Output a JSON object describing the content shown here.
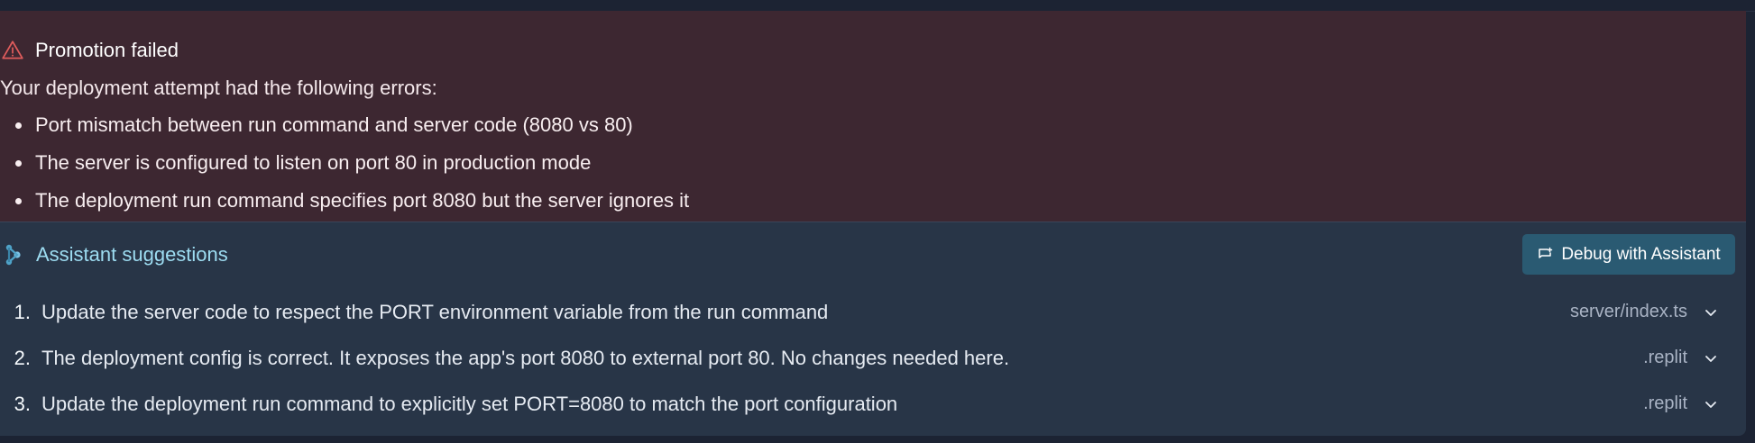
{
  "error": {
    "title": "Promotion failed",
    "intro": "Your deployment attempt had the following errors:",
    "items": [
      "Port mismatch between run command and server code (8080 vs 80)",
      "The server is configured to listen on port 80 in production mode",
      "The deployment run command specifies port 8080 but the server ignores it"
    ]
  },
  "assistant": {
    "title": "Assistant suggestions",
    "debug_button": "Debug with Assistant",
    "suggestions": [
      {
        "num": "1.",
        "text": "Update the server code to respect the PORT environment variable from the run command",
        "file": "server/index.ts"
      },
      {
        "num": "2.",
        "text": "The deployment config is correct. It exposes the app's port 8080 to external port 80. No changes needed here.",
        "file": ".replit"
      },
      {
        "num": "3.",
        "text": "Update the deployment run command to explicitly set PORT=8080 to match the port configuration",
        "file": ".replit"
      }
    ]
  },
  "colors": {
    "error_bg": "#3d2731",
    "assist_bg": "#283547",
    "accent": "#9ddcf1",
    "warning": "#e05c5c",
    "button": "#2a5a72"
  },
  "icons": [
    "warning-icon",
    "assistant-icon",
    "chat-icon",
    "chevron-down-icon"
  ]
}
